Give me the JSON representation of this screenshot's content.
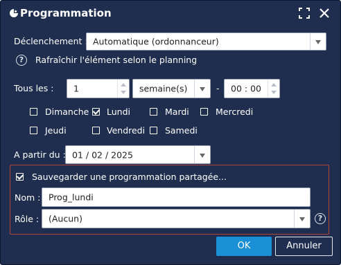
{
  "window": {
    "title": "Programmation",
    "icon": "app-logo-icon",
    "maximize_icon": "maximize-icon",
    "close_icon": "close-icon"
  },
  "trigger": {
    "label": "Déclenchement :",
    "value": "Automatique (ordonnanceur)"
  },
  "refresh_hint": {
    "icon": "help-icon",
    "text": "Rafraîchir l'élément selon le planning"
  },
  "every": {
    "label": "Tous les :",
    "count": "1",
    "unit": "semaine(s)",
    "separator": "-",
    "time": "00 : 00"
  },
  "days": [
    {
      "label": "Dimanche",
      "checked": false
    },
    {
      "label": "Lundi",
      "checked": true
    },
    {
      "label": "Mardi",
      "checked": false
    },
    {
      "label": "Mercredi",
      "checked": false
    },
    {
      "label": "Jeudi",
      "checked": false
    },
    {
      "label": "Vendredi",
      "checked": false
    },
    {
      "label": "Samedi",
      "checked": false
    }
  ],
  "start": {
    "label": "A partir du :",
    "value": "01 / 02 / 2025"
  },
  "shared": {
    "checkbox_label": "Sauvegarder une programmation partagée...",
    "checked": true,
    "name_label": "Nom :",
    "name_value": "Prog_lundi",
    "role_label": "Rôle :",
    "role_value": "(Aucun)",
    "highlight_color": "#b5453a"
  },
  "buttons": {
    "ok": "OK",
    "cancel": "Annuler"
  },
  "colors": {
    "background": "#1f2e4e",
    "accent": "#1a8fd6"
  }
}
